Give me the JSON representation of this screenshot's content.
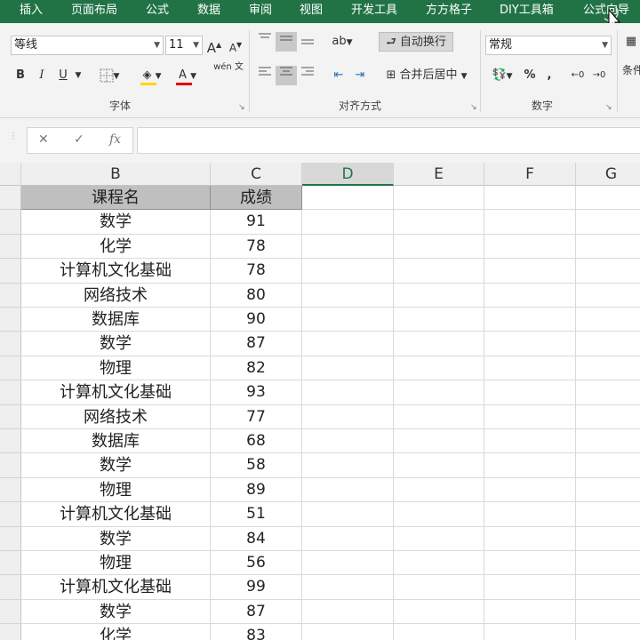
{
  "ribbon_tabs": [
    "插入",
    "页面布局",
    "公式",
    "数据",
    "审阅",
    "视图",
    "开发工具",
    "方方格子",
    "DIY工具箱",
    "公式向导"
  ],
  "font": {
    "name": "等线",
    "size": "11",
    "increase_label": "A",
    "decrease_label": "A",
    "bold": "B",
    "italic": "I",
    "underline": "U",
    "font_color_label": "A",
    "pinyin_label": "wén 文",
    "group_label": "字体"
  },
  "alignment": {
    "wrap_text": "自动换行",
    "merge_center": "合并后居中",
    "group_label": "对齐方式"
  },
  "number": {
    "format": "常规",
    "percent": "%",
    "comma": ",",
    "group_label": "数字"
  },
  "conditional_label": "条件",
  "formula_bar": {
    "cancel": "✕",
    "enter": "✓",
    "fx": "fx",
    "value": ""
  },
  "columns": [
    "B",
    "C",
    "D",
    "E",
    "F",
    "G"
  ],
  "selected_column": "D",
  "table": {
    "headers": [
      "课程名",
      "成绩"
    ],
    "rows": [
      [
        "数学",
        "91"
      ],
      [
        "化学",
        "78"
      ],
      [
        "计算机文化基础",
        "78"
      ],
      [
        "网络技术",
        "80"
      ],
      [
        "数据库",
        "90"
      ],
      [
        "数学",
        "87"
      ],
      [
        "物理",
        "82"
      ],
      [
        "计算机文化基础",
        "93"
      ],
      [
        "网络技术",
        "77"
      ],
      [
        "数据库",
        "68"
      ],
      [
        "数学",
        "58"
      ],
      [
        "物理",
        "89"
      ],
      [
        "计算机文化基础",
        "51"
      ],
      [
        "数学",
        "84"
      ],
      [
        "物理",
        "56"
      ],
      [
        "计算机文化基础",
        "99"
      ],
      [
        "数学",
        "87"
      ],
      [
        "化学",
        "83"
      ]
    ]
  },
  "colors": {
    "ribbon_green": "#217346",
    "header_fill": "#bfbfbf"
  }
}
